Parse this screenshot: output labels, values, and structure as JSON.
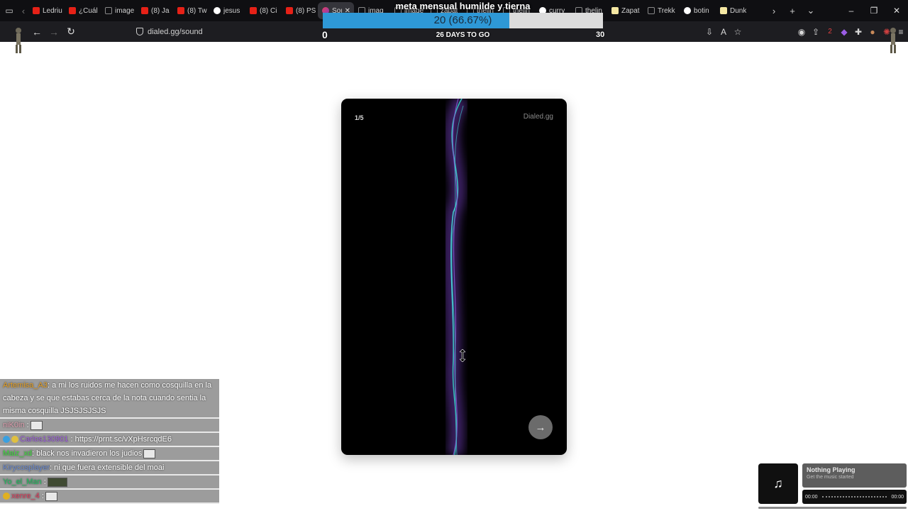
{
  "browser": {
    "tabs": [
      {
        "title": "Ledriu",
        "icon": "youtube-icon"
      },
      {
        "title": "¿Cuál",
        "icon": "youtube-icon"
      },
      {
        "title": "image",
        "icon": "image-icon"
      },
      {
        "title": "(8) Ja",
        "icon": "youtube-icon"
      },
      {
        "title": "(8) Tw",
        "icon": "youtube-icon"
      },
      {
        "title": "jesus",
        "icon": "google-icon"
      },
      {
        "title": "(8) Ci",
        "icon": "youtube-icon"
      },
      {
        "title": "(8) PS",
        "icon": "youtube-icon"
      },
      {
        "title": "Sou",
        "icon": "sound-icon",
        "active": true
      },
      {
        "title": "imag",
        "icon": "image-icon"
      },
      {
        "title": "image",
        "icon": "image-icon"
      },
      {
        "title": "zapat",
        "icon": "image-icon"
      },
      {
        "title": "thelin",
        "icon": "image-icon"
      },
      {
        "title": "thelin",
        "icon": "image-icon"
      },
      {
        "title": "curry",
        "icon": "google-icon"
      },
      {
        "title": "thelin",
        "icon": "image-icon"
      },
      {
        "title": "Zapat",
        "icon": "note-icon"
      },
      {
        "title": "Trekk",
        "icon": "image-icon"
      },
      {
        "title": "botin",
        "icon": "google-icon"
      },
      {
        "title": "Dunk",
        "icon": "note-icon"
      }
    ],
    "url": "dialed.gg/sound",
    "extension_badge": "2"
  },
  "goal": {
    "title": "meta mensual humilde y tierna",
    "progress_text": "20 (66.67%)",
    "current": 20,
    "percent": 66.67,
    "min": "0",
    "max": "30",
    "days_left": "26 DAYS TO GO"
  },
  "card": {
    "counter": "1/5",
    "brand": "Dialed.gg",
    "next_arrow": "→"
  },
  "chat": [
    {
      "user": "Artemisa_A3",
      "color": "#e8a020",
      "text": ": a mi los ruidos me hacen como cosquilla en la cabeza y se que estabas cerca de la nota cuando sentia la misma cosquilla JSJSJSJSJS",
      "emote": false
    },
    {
      "user": "niK0in",
      "color": "#e0a0b0",
      "text": " :",
      "emote": true
    },
    {
      "user": "Carlos130901",
      "color": "#a060e0",
      "text": " : https://prnt.sc/vXpHsrcqdE6",
      "emote": false,
      "badges": true
    },
    {
      "user": "Maiz_xd",
      "color": "#40e040",
      "text": ": black nos invadieron los judios",
      "emote": true
    },
    {
      "user": "Kirycosplayer",
      "color": "#6a8ad0",
      "text": ": ni que fuera extensible del moai",
      "emote": false
    },
    {
      "user": "Yo_el_Man",
      "color": "#20c060",
      "text": " :",
      "emote": true,
      "wide": true
    },
    {
      "user": "xenre_4",
      "color": "#e04060",
      "text": " :",
      "emote": true,
      "badge": true
    }
  ],
  "now_playing": {
    "title": "Nothing Playing",
    "subtitle": "Get the music started",
    "time_start": "00:00",
    "time_end": "00:00"
  }
}
